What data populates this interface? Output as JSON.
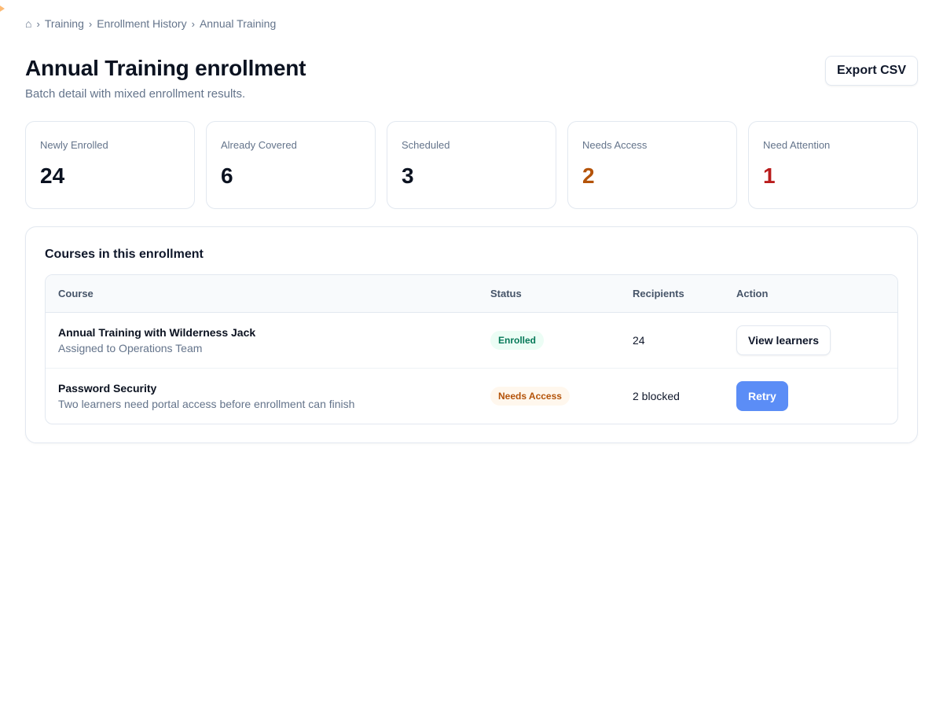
{
  "breadcrumb": {
    "home_icon": "⌂",
    "separator": "›",
    "items": [
      "Training",
      "Enrollment History",
      "Annual Training"
    ]
  },
  "header": {
    "title": "Annual Training enrollment",
    "subtitle": "Batch detail with mixed enrollment results.",
    "export_label": "Export CSV"
  },
  "stats": [
    {
      "label": "Newly Enrolled",
      "value": "24"
    },
    {
      "label": "Already Covered",
      "value": "6"
    },
    {
      "label": "Scheduled",
      "value": "3"
    },
    {
      "label": "Needs Access",
      "value": "2"
    },
    {
      "label": "Need Attention",
      "value": "1"
    }
  ],
  "courses": {
    "title": "Courses in this enrollment",
    "columns": [
      "Course",
      "Status",
      "Recipients",
      "Action"
    ],
    "rows": [
      {
        "name": "Annual Training with Wilderness Jack",
        "description": "Assigned to Operations Team",
        "status": "Enrolled",
        "recipients": "24",
        "action": "View learners"
      },
      {
        "name": "Password Security",
        "description": "Two learners need portal access before enrollment can finish",
        "status": "Needs Access",
        "recipients": "2 blocked",
        "action": "Retry"
      }
    ]
  },
  "colors": {
    "warning": "#b45309",
    "danger": "#b91c1c",
    "primary": "#5b8df6",
    "success": "#047857"
  }
}
